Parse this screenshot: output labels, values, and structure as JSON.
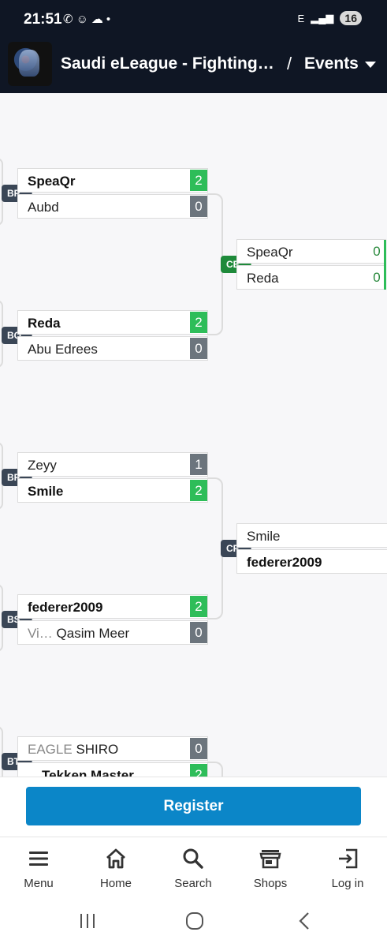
{
  "status_bar": {
    "time": "21:51",
    "battery": "16",
    "net_label": "E"
  },
  "header": {
    "title": "Saudi eLeague - Fighting ...",
    "separator": "/",
    "events_label": "Events"
  },
  "matches": [
    {
      "id": "BP",
      "players": [
        {
          "name": "SpeaQr",
          "score": "2",
          "winner": true
        },
        {
          "name": "Aubd",
          "score": "0",
          "winner": false
        }
      ]
    },
    {
      "id": "BQ",
      "players": [
        {
          "name": "Reda",
          "score": "2",
          "winner": true
        },
        {
          "name": "Abu Edrees",
          "score": "0",
          "winner": false
        }
      ]
    },
    {
      "id": "BR",
      "players": [
        {
          "name": "Zeyy",
          "score": "1",
          "winner": false
        },
        {
          "name": "Smile",
          "score": "2",
          "winner": true
        }
      ]
    },
    {
      "id": "BS",
      "players": [
        {
          "name": "federer2009",
          "score": "2",
          "winner": true
        },
        {
          "tag": "Vi…",
          "name": "Qasim Meer",
          "score": "0",
          "winner": false
        }
      ]
    },
    {
      "id": "BT",
      "players": [
        {
          "tag": "EAGLE",
          "name": "SHIRO",
          "score": "0",
          "winner": false
        },
        {
          "name": "Tekken Master",
          "score": "2",
          "winner": true
        }
      ]
    },
    {
      "id": "CE",
      "players": [
        {
          "name": "SpeaQr",
          "score": "0"
        },
        {
          "name": "Reda",
          "score": "0"
        }
      ]
    },
    {
      "id": "CF",
      "players": [
        {
          "name": "Smile",
          "score": ""
        },
        {
          "name": "federer2009",
          "score": ""
        }
      ]
    }
  ],
  "register": {
    "label": "Register"
  },
  "bottom_nav": [
    {
      "label": "Menu",
      "icon": "menu-icon"
    },
    {
      "label": "Home",
      "icon": "home-icon"
    },
    {
      "label": "Search",
      "icon": "search-icon"
    },
    {
      "label": "Shops",
      "icon": "shop-icon"
    },
    {
      "label": "Log in",
      "icon": "login-icon"
    }
  ],
  "colors": {
    "header_bg": "#0f1624",
    "win": "#2ebd59",
    "loss": "#6c757d",
    "badge": "#3a4656",
    "badge_live": "#1e8a3a",
    "register": "#0b86c8"
  }
}
